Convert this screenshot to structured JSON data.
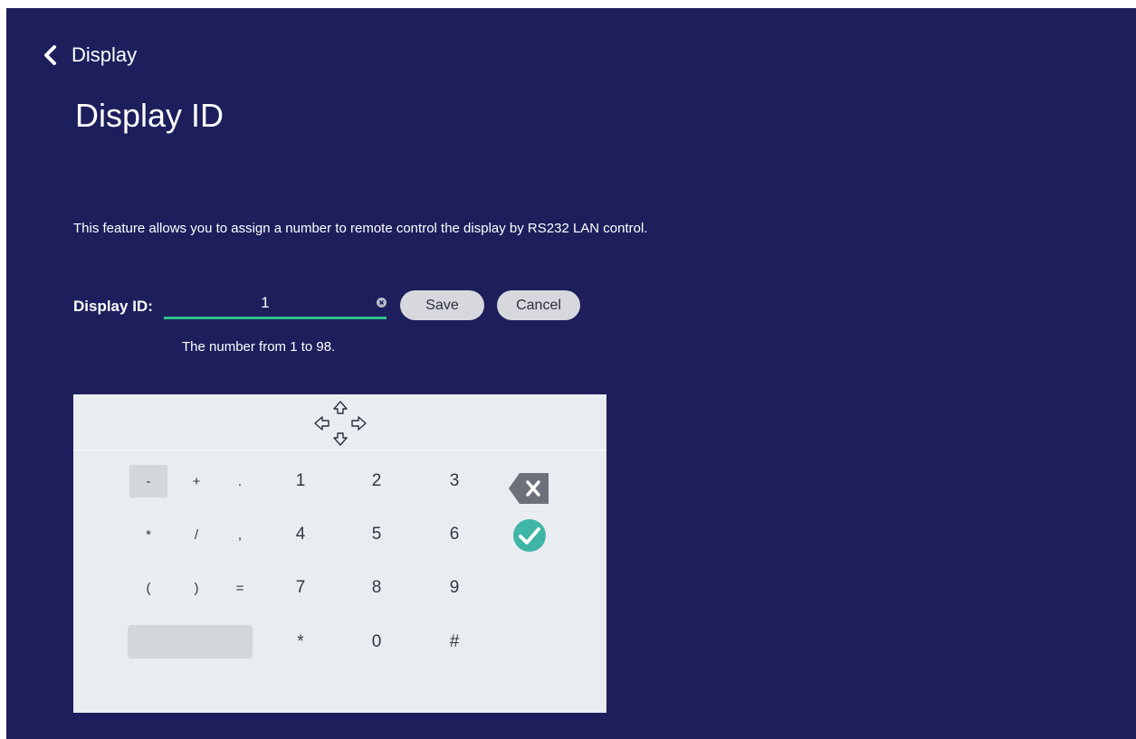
{
  "nav": {
    "back_label": "Display"
  },
  "page": {
    "title": "Display ID",
    "description": "This feature allows you to assign a number to remote control the display by RS232 LAN control."
  },
  "form": {
    "label": "Display ID:",
    "value": "1",
    "hint": "The number from 1 to 98.",
    "save_label": "Save",
    "cancel_label": "Cancel"
  },
  "keypad": {
    "rows": [
      [
        "-",
        "+",
        ".",
        "1",
        "2",
        "3"
      ],
      [
        "*",
        "/",
        ",",
        "4",
        "5",
        "6"
      ],
      [
        "(",
        ")",
        "=",
        "7",
        "8",
        "9"
      ],
      [
        "*",
        "0",
        "#"
      ]
    ],
    "icons": [
      "move-icon",
      "backspace-icon",
      "confirm-check-icon",
      "clear-icon",
      "chevron-left-icon"
    ]
  },
  "colors": {
    "background": "#1c1f5c",
    "underline": "#2fc08a",
    "confirm": "#3fb5a6",
    "keypad": "#e9ecf1"
  }
}
